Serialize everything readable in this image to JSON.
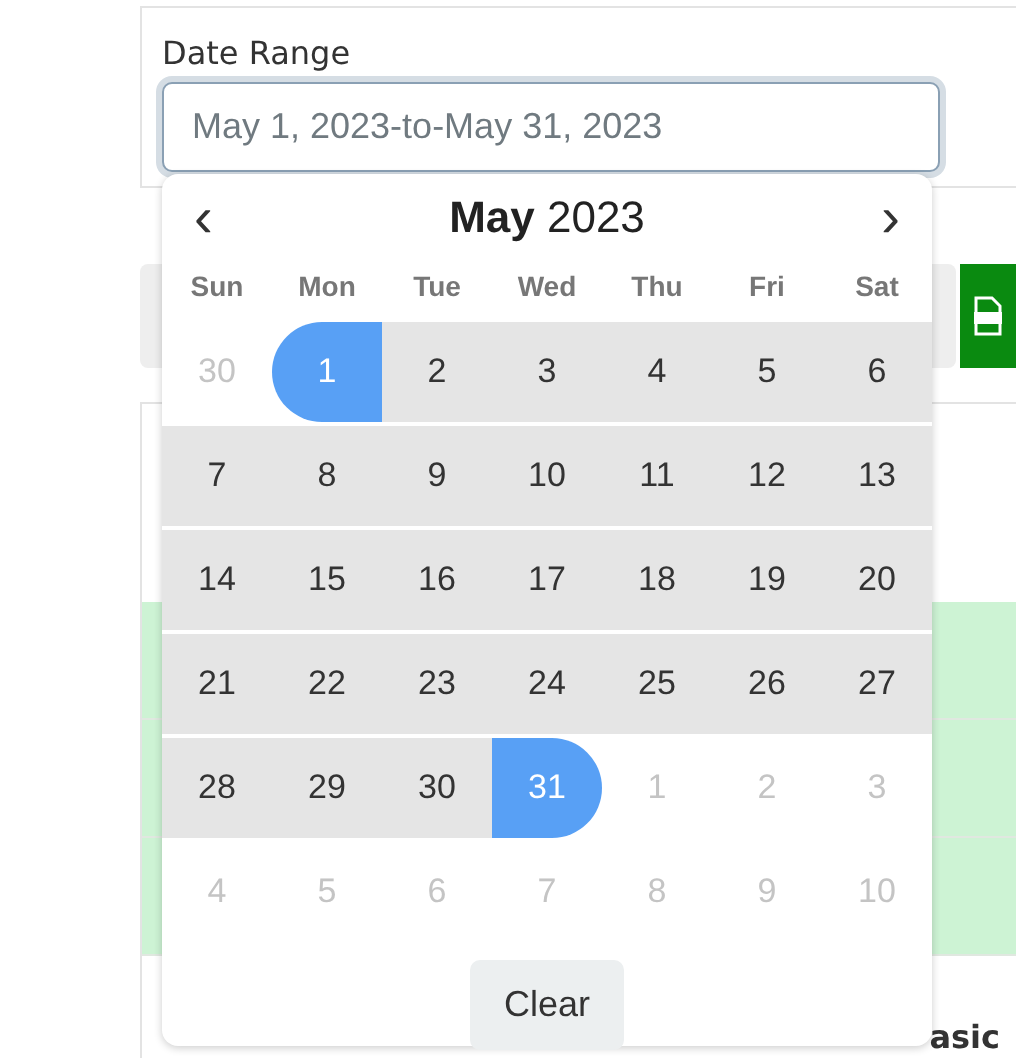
{
  "date_range": {
    "label": "Date Range",
    "value": "May 1, 2023-to-May 31, 2023"
  },
  "calendar": {
    "prev": "‹",
    "next": "›",
    "month": "May",
    "year": "2023",
    "weekdays": [
      "Sun",
      "Mon",
      "Tue",
      "Wed",
      "Thu",
      "Fri",
      "Sat"
    ],
    "weeks": [
      [
        {
          "label": "30",
          "kind": "other",
          "in_range": false,
          "selected": false
        },
        {
          "label": "1",
          "kind": "current",
          "in_range": true,
          "selected": true
        },
        {
          "label": "2",
          "kind": "current",
          "in_range": true,
          "selected": false
        },
        {
          "label": "3",
          "kind": "current",
          "in_range": true,
          "selected": false
        },
        {
          "label": "4",
          "kind": "current",
          "in_range": true,
          "selected": false
        },
        {
          "label": "5",
          "kind": "current",
          "in_range": true,
          "selected": false
        },
        {
          "label": "6",
          "kind": "current",
          "in_range": true,
          "selected": false
        }
      ],
      [
        {
          "label": "7",
          "kind": "current",
          "in_range": true,
          "selected": false
        },
        {
          "label": "8",
          "kind": "current",
          "in_range": true,
          "selected": false
        },
        {
          "label": "9",
          "kind": "current",
          "in_range": true,
          "selected": false
        },
        {
          "label": "10",
          "kind": "current",
          "in_range": true,
          "selected": false
        },
        {
          "label": "11",
          "kind": "current",
          "in_range": true,
          "selected": false
        },
        {
          "label": "12",
          "kind": "current",
          "in_range": true,
          "selected": false
        },
        {
          "label": "13",
          "kind": "current",
          "in_range": true,
          "selected": false
        }
      ],
      [
        {
          "label": "14",
          "kind": "current",
          "in_range": true,
          "selected": false
        },
        {
          "label": "15",
          "kind": "current",
          "in_range": true,
          "selected": false
        },
        {
          "label": "16",
          "kind": "current",
          "in_range": true,
          "selected": false
        },
        {
          "label": "17",
          "kind": "current",
          "in_range": true,
          "selected": false
        },
        {
          "label": "18",
          "kind": "current",
          "in_range": true,
          "selected": false
        },
        {
          "label": "19",
          "kind": "current",
          "in_range": true,
          "selected": false
        },
        {
          "label": "20",
          "kind": "current",
          "in_range": true,
          "selected": false
        }
      ],
      [
        {
          "label": "21",
          "kind": "current",
          "in_range": true,
          "selected": false
        },
        {
          "label": "22",
          "kind": "current",
          "in_range": true,
          "selected": false
        },
        {
          "label": "23",
          "kind": "current",
          "in_range": true,
          "selected": false
        },
        {
          "label": "24",
          "kind": "current",
          "in_range": true,
          "selected": false
        },
        {
          "label": "25",
          "kind": "current",
          "in_range": true,
          "selected": false
        },
        {
          "label": "26",
          "kind": "current",
          "in_range": true,
          "selected": false
        },
        {
          "label": "27",
          "kind": "current",
          "in_range": true,
          "selected": false
        }
      ],
      [
        {
          "label": "28",
          "kind": "current",
          "in_range": true,
          "selected": false
        },
        {
          "label": "29",
          "kind": "current",
          "in_range": true,
          "selected": false
        },
        {
          "label": "30",
          "kind": "current",
          "in_range": true,
          "selected": false
        },
        {
          "label": "31",
          "kind": "current",
          "in_range": true,
          "selected": true
        },
        {
          "label": "1",
          "kind": "other",
          "in_range": false,
          "selected": false
        },
        {
          "label": "2",
          "kind": "other",
          "in_range": false,
          "selected": false
        },
        {
          "label": "3",
          "kind": "other",
          "in_range": false,
          "selected": false
        }
      ],
      [
        {
          "label": "4",
          "kind": "other",
          "in_range": false,
          "selected": false
        },
        {
          "label": "5",
          "kind": "other",
          "in_range": false,
          "selected": false
        },
        {
          "label": "6",
          "kind": "other",
          "in_range": false,
          "selected": false
        },
        {
          "label": "7",
          "kind": "other",
          "in_range": false,
          "selected": false
        },
        {
          "label": "8",
          "kind": "other",
          "in_range": false,
          "selected": false
        },
        {
          "label": "9",
          "kind": "other",
          "in_range": false,
          "selected": false
        },
        {
          "label": "10",
          "kind": "other",
          "in_range": false,
          "selected": false
        }
      ]
    ],
    "clear_button": "Clear"
  },
  "table": {
    "rows": [
      {
        "color": "#cdf3d4"
      },
      {
        "color": "#cdf3d4"
      },
      {
        "color": "#cdf3d4"
      }
    ],
    "column_header": "asic"
  }
}
